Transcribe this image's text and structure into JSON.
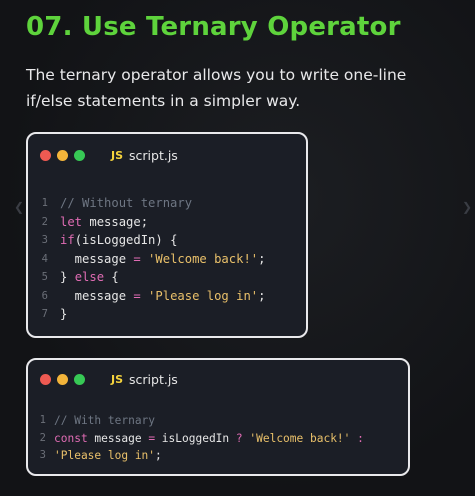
{
  "header": {
    "title": "07. Use Ternary Operator",
    "description": "The ternary operator allows you to write one-line if/else statements in a simpler way."
  },
  "nav": {
    "prev_icon": "chevron-left-icon",
    "next_icon": "chevron-right-icon"
  },
  "colors": {
    "accent": "#5ed33c",
    "dot_red": "#ee5a52",
    "dot_yellow": "#f3b43a",
    "dot_green": "#37c955"
  },
  "window1": {
    "filename": "script.js",
    "badge": "JS",
    "lines": [
      {
        "n": "1",
        "tokens": [
          {
            "t": "// Without ternary",
            "k": "comment"
          }
        ]
      },
      {
        "n": "2",
        "tokens": [
          {
            "t": "let ",
            "k": "keyword"
          },
          {
            "t": "message;",
            "k": "plain"
          }
        ]
      },
      {
        "n": "3",
        "tokens": [
          {
            "t": "if",
            "k": "keyword"
          },
          {
            "t": "(isLoggedIn) {",
            "k": "plain"
          }
        ]
      },
      {
        "n": "4",
        "tokens": [
          {
            "t": "  message ",
            "k": "plain"
          },
          {
            "t": "=",
            "k": "op"
          },
          {
            "t": " 'Welcome back!'",
            "k": "string"
          },
          {
            "t": ";",
            "k": "plain"
          }
        ]
      },
      {
        "n": "5",
        "tokens": [
          {
            "t": "} ",
            "k": "plain"
          },
          {
            "t": "else",
            "k": "keyword"
          },
          {
            "t": " {",
            "k": "plain"
          }
        ]
      },
      {
        "n": "6",
        "tokens": [
          {
            "t": "  message ",
            "k": "plain"
          },
          {
            "t": "=",
            "k": "op"
          },
          {
            "t": " 'Please log in'",
            "k": "string"
          },
          {
            "t": ";",
            "k": "plain"
          }
        ]
      },
      {
        "n": "7",
        "tokens": [
          {
            "t": "}",
            "k": "plain"
          }
        ]
      }
    ]
  },
  "window2": {
    "filename": "script.js",
    "badge": "JS",
    "lines": [
      {
        "n": "1",
        "tokens": [
          {
            "t": "// With ternary",
            "k": "comment"
          }
        ]
      },
      {
        "n": "2",
        "tokens": [
          {
            "t": "const ",
            "k": "keyword"
          },
          {
            "t": "message ",
            "k": "plain"
          },
          {
            "t": "=",
            "k": "op"
          },
          {
            "t": " isLoggedIn ",
            "k": "plain"
          },
          {
            "t": "?",
            "k": "op"
          },
          {
            "t": " 'Welcome back!' ",
            "k": "string"
          },
          {
            "t": ":",
            "k": "op"
          }
        ]
      },
      {
        "n": "3",
        "tokens": [
          {
            "t": "'Please log in'",
            "k": "string"
          },
          {
            "t": ";",
            "k": "plain"
          }
        ]
      }
    ]
  }
}
